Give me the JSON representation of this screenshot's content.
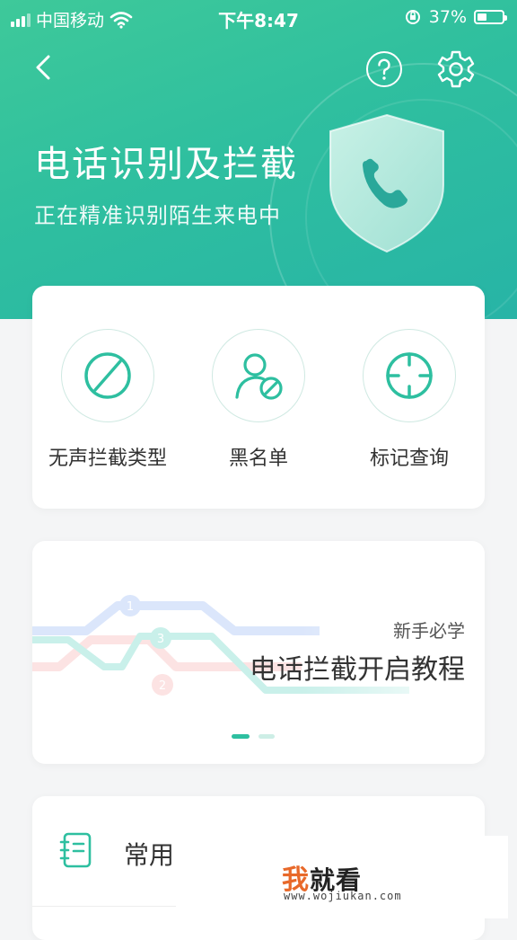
{
  "status_bar": {
    "carrier": "中国移动",
    "time": "下午8:47",
    "battery_percent": "37%",
    "battery_level": 0.37
  },
  "nav": {
    "back_icon": "chevron-left-icon",
    "help_icon": "question-circle-icon",
    "settings_icon": "gear-icon"
  },
  "header": {
    "title": "电话识别及拦截",
    "subtitle": "正在精准识别陌生来电中"
  },
  "functions": [
    {
      "label": "无声拦截类型",
      "icon": "block-icon"
    },
    {
      "label": "黑名单",
      "icon": "user-blocked-icon"
    },
    {
      "label": "标记查询",
      "icon": "crosshair-icon"
    }
  ],
  "banner": {
    "tag": "新手必学",
    "title": "电话拦截开启教程",
    "art_numbers": [
      "1",
      "3",
      "2"
    ],
    "page_count": 2,
    "active_page": 1
  },
  "common": {
    "label": "常用",
    "icon": "notebook-icon"
  },
  "watermark": {
    "brand_first": "我",
    "brand_rest": "就看",
    "url": "www.wojiukan.com"
  },
  "colors": {
    "accent": "#2ebfa0",
    "gradient_start": "#3ec99a",
    "gradient_end": "#27b4a6"
  }
}
